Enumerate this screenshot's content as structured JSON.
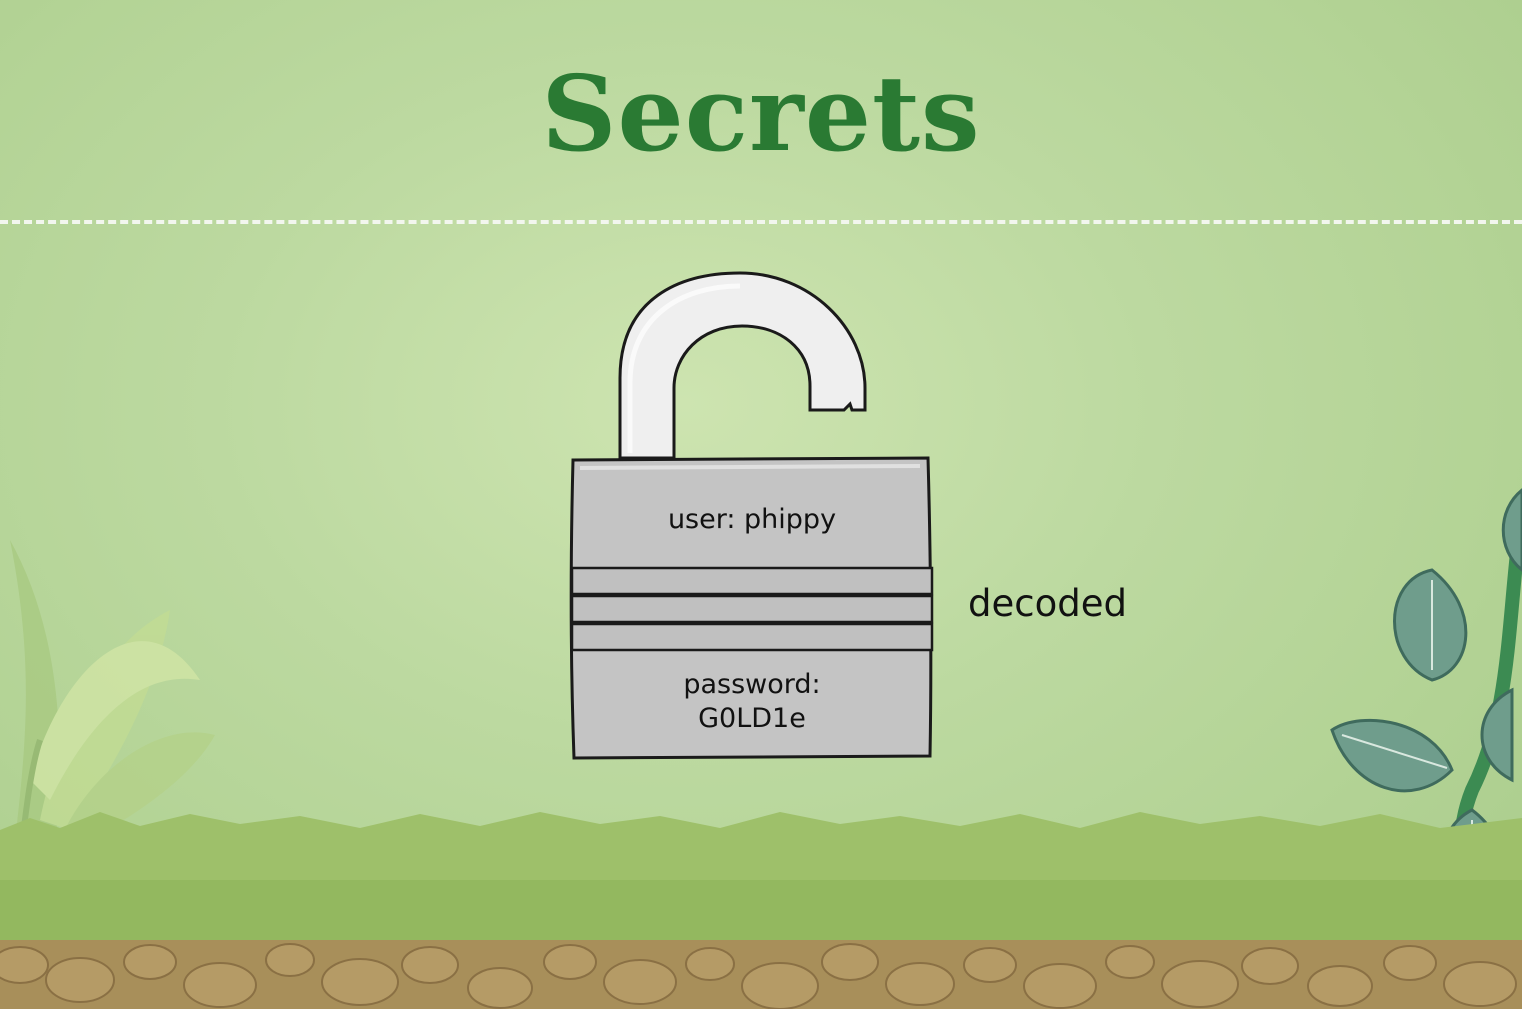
{
  "title": "Secrets",
  "lock": {
    "user_line": "user: phippy",
    "password_label": "password:",
    "password_value": "G0LD1e"
  },
  "state_label": "decoded",
  "icons": {
    "lock": "open-padlock-icon",
    "plant_left": "leafy-plant-icon",
    "plant_right": "vine-plant-icon",
    "ground": "soil-and-grass"
  },
  "colors": {
    "title": "#2a7a33",
    "background": "#bcd9a0",
    "lock_body": "#c4c4c4"
  }
}
